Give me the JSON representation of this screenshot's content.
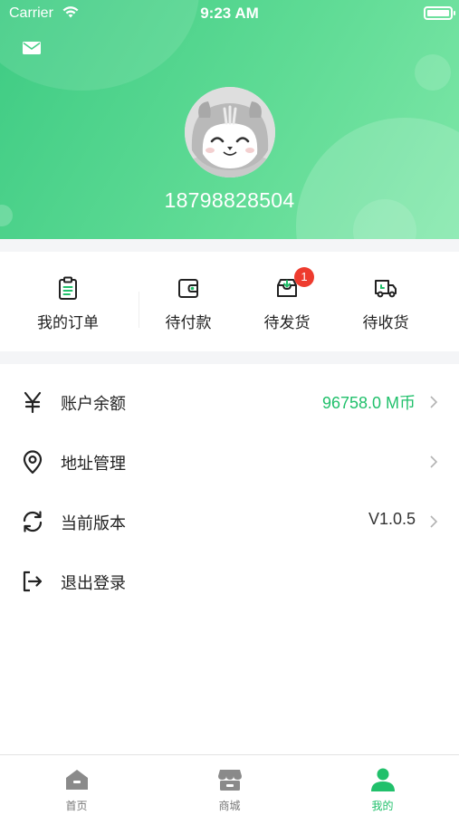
{
  "status_bar": {
    "carrier": "Carrier",
    "time": "9:23 AM"
  },
  "header": {
    "phone": "18798828504",
    "mail_icon": "mail-icon",
    "avatar": "hamster-avatar",
    "colors": {
      "gradient_start": "#3ecb83",
      "gradient_end": "#7ee7a8"
    }
  },
  "orders": [
    {
      "label": "我的订单",
      "icon": "clipboard-list-icon"
    },
    {
      "label": "待付款",
      "icon": "wallet-icon"
    },
    {
      "label": "待发货",
      "icon": "inbox-download-icon",
      "badge": "1"
    },
    {
      "label": "待收货",
      "icon": "truck-icon"
    }
  ],
  "menu": [
    {
      "icon": "yen-icon",
      "title": "账户余额",
      "value": "96758.0 M币",
      "value_color": "#21c06b"
    },
    {
      "icon": "location-pin-icon",
      "title": "地址管理",
      "value": ""
    },
    {
      "icon": "refresh-icon",
      "title": "当前版本",
      "value": "V1.0.5"
    },
    {
      "icon": "logout-icon",
      "title": "退出登录",
      "value": ""
    }
  ],
  "tabbar": [
    {
      "label": "首页",
      "icon": "home-icon",
      "active": false
    },
    {
      "label": "商城",
      "icon": "store-icon",
      "active": false
    },
    {
      "label": "我的",
      "icon": "user-icon",
      "active": true
    }
  ],
  "colors": {
    "accent": "#21c06b",
    "badge": "#ee3b2e",
    "inactive_tab": "#777777"
  }
}
